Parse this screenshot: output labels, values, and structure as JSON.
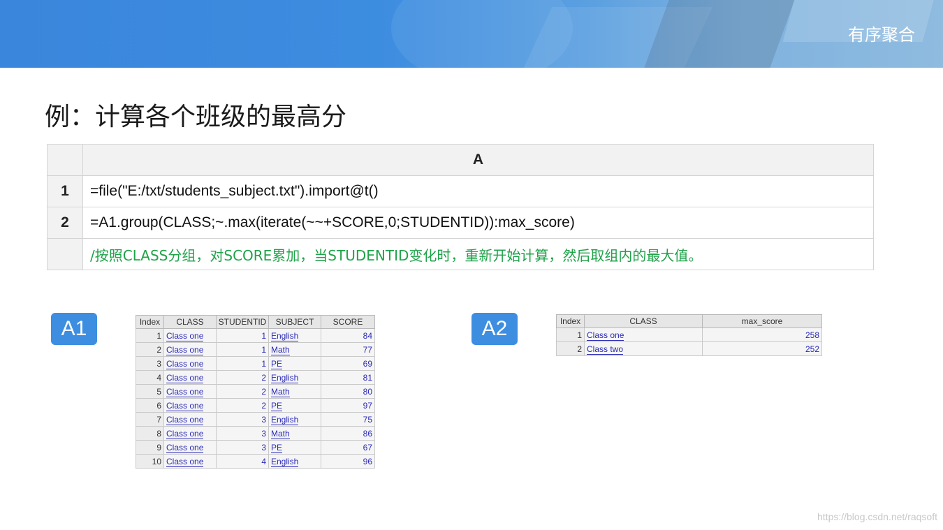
{
  "header": {
    "title": "有序聚合"
  },
  "example_title": "例：计算各个班级的最高分",
  "grid": {
    "column": "A",
    "rows": [
      {
        "num": "1",
        "text": "=file(\"E:/txt/students_subject.txt\").import@t()"
      },
      {
        "num": "2",
        "text": "=A1.group(CLASS;~.max(iterate(~~+SCORE,0;STUDENTID)):max_score)"
      },
      {
        "num": "",
        "text": "/按照CLASS分组，对SCORE累加，当STUDENTID变化时，重新开始计算，然后取组内的最大值。"
      }
    ]
  },
  "badges": {
    "a1": "A1",
    "a2": "A2"
  },
  "table_a1": {
    "headers": [
      "Index",
      "CLASS",
      "STUDENTID",
      "SUBJECT",
      "SCORE"
    ],
    "rows": [
      [
        "1",
        "Class one",
        "1",
        "English",
        "84"
      ],
      [
        "2",
        "Class one",
        "1",
        "Math",
        "77"
      ],
      [
        "3",
        "Class one",
        "1",
        "PE",
        "69"
      ],
      [
        "4",
        "Class one",
        "2",
        "English",
        "81"
      ],
      [
        "5",
        "Class one",
        "2",
        "Math",
        "80"
      ],
      [
        "6",
        "Class one",
        "2",
        "PE",
        "97"
      ],
      [
        "7",
        "Class one",
        "3",
        "English",
        "75"
      ],
      [
        "8",
        "Class one",
        "3",
        "Math",
        "86"
      ],
      [
        "9",
        "Class one",
        "3",
        "PE",
        "67"
      ],
      [
        "10",
        "Class one",
        "4",
        "English",
        "96"
      ]
    ]
  },
  "table_a2": {
    "headers": [
      "Index",
      "CLASS",
      "max_score"
    ],
    "rows": [
      [
        "1",
        "Class one",
        "258"
      ],
      [
        "2",
        "Class two",
        "252"
      ]
    ]
  },
  "watermark": "https://blog.csdn.net/raqsoft",
  "colors": {
    "banner": "#3d8ee0",
    "comment": "#1fa24a",
    "link": "#2a2ab8"
  }
}
